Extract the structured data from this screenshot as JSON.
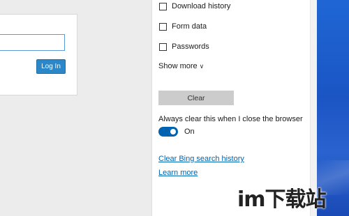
{
  "login": {
    "button_label": "Log In"
  },
  "clear_data": {
    "items": [
      {
        "label": "Download history",
        "checked": false
      },
      {
        "label": "Form data",
        "checked": false
      },
      {
        "label": "Passwords",
        "checked": false
      }
    ],
    "show_more_label": "Show more",
    "clear_button_label": "Clear",
    "always_clear_label": "Always clear this when I close the browser",
    "toggle_state_label": "On",
    "toggle_on": true,
    "links": {
      "clear_bing": "Clear Bing search history",
      "learn_more": "Learn more"
    }
  },
  "colors": {
    "accent": "#0063b1",
    "login_button": "#2b87c7",
    "desktop_blue": "#1f66d4"
  },
  "watermark": {
    "text": "im下载站"
  }
}
